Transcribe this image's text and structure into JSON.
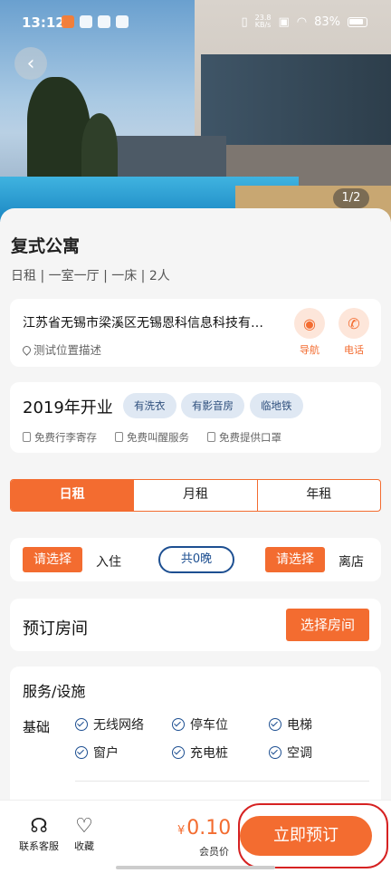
{
  "status_bar": {
    "time": "13:12",
    "net_speed_value": "23.8",
    "net_speed_unit": "KB/s",
    "battery": "83%"
  },
  "gallery": {
    "counter": "1/2"
  },
  "listing": {
    "title": "复式公寓",
    "subtitle": "日租 | 一室一厅 | 一床 | 2人"
  },
  "address": {
    "line": "江苏省无锡市梁溪区无锡恩科信息科技有…",
    "location_desc": "测试位置描述",
    "nav_label": "导航",
    "phone_label": "电话"
  },
  "opening": {
    "year": "2019年开业",
    "tags": [
      "有洗衣",
      "有影音房",
      "临地铁"
    ],
    "services": [
      "免费行李寄存",
      "免费叫醒服务",
      "免费提供口罩"
    ]
  },
  "rent_tabs": {
    "items": [
      "日租",
      "月租",
      "年租"
    ],
    "selected": "日租"
  },
  "dates": {
    "checkin_pick": "请选择",
    "checkin_label": "入住",
    "nights": "共0晚",
    "checkout_pick": "请选择",
    "checkout_label": "离店"
  },
  "booking": {
    "title": "预订房间",
    "choose_label": "选择房间"
  },
  "facilities": {
    "title": "服务/设施",
    "category": "基础",
    "items": [
      "无线网络",
      "停车位",
      "电梯",
      "窗户",
      "充电桩",
      "空调"
    ]
  },
  "bottom_bar": {
    "service_label": "联系客服",
    "favorite_label": "收藏",
    "currency": "¥",
    "price": "0.10",
    "price_label": "会员价",
    "order_label": "立即预订"
  },
  "colors": {
    "accent": "#f36c30",
    "tag_text": "#2e4f7d",
    "highlight_ring": "#d62222"
  }
}
